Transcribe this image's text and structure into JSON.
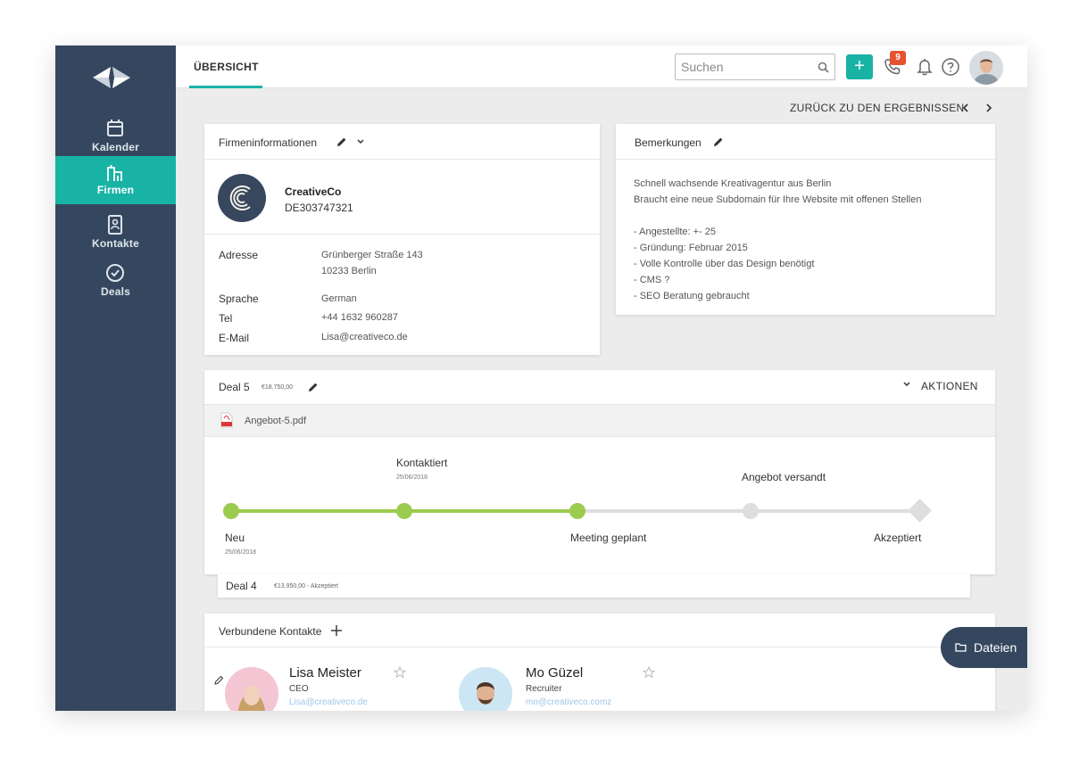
{
  "sidebar": {
    "items": [
      {
        "label": "Kalender",
        "icon": "calendar-icon"
      },
      {
        "label": "Firmen",
        "icon": "buildings-icon",
        "active": true
      },
      {
        "label": "Kontakte",
        "icon": "address-book-icon"
      },
      {
        "label": "Deals",
        "icon": "check-circle-icon"
      }
    ]
  },
  "topbar": {
    "tab": "ÜBERSICHT",
    "search_placeholder": "Suchen",
    "add_label": "+",
    "phone_badge": "9"
  },
  "back_link": "ZURÜCK ZU DEN ERGEBNISSEN",
  "company_card": {
    "title": "Firmeninformationen",
    "name": "CreativeCo",
    "vat": "DE303747321",
    "address_label": "Adresse",
    "address_line1": "Grünberger Straße 143",
    "address_line2": "10233 Berlin",
    "language_label": "Sprache",
    "language": "German",
    "phone_label": "Tel",
    "phone": "+44 1632 960287",
    "email_label": "E-Mail",
    "email": "Lisa@creativeco.de"
  },
  "notes_card": {
    "title": "Bemerkungen",
    "lines": [
      "Schnell wachsende Kreativagentur aus Berlin",
      "Braucht eine neue Subdomain für Ihre Website mit offenen Stellen",
      "- Angestellte: +- 25",
      "- Gründung: Februar 2015",
      "- Volle Kontrolle über das Design benötigt",
      "- CMS ?",
      "- SEO Beratung gebraucht"
    ]
  },
  "deal5": {
    "title": "Deal 5",
    "amount": "€18.750,00",
    "actions": "AKTIONEN",
    "file": "Angebot-5.pdf",
    "stages": [
      {
        "label": "Neu",
        "date": "25/06/2018",
        "done": true
      },
      {
        "label": "Kontaktiert",
        "date": "25/06/2018",
        "done": true
      },
      {
        "label": "Meeting geplant",
        "date": "",
        "done": true
      },
      {
        "label": "Angebot versandt",
        "date": "",
        "done": false
      },
      {
        "label": "Akzeptiert",
        "date": "",
        "done": false
      }
    ]
  },
  "deal4": {
    "title": "Deal 4",
    "meta": "€13.950,00 - Akzeptiert"
  },
  "contacts_card": {
    "title": "Verbundene Kontakte",
    "contacts": [
      {
        "name": "Lisa Meister",
        "role": "CEO",
        "email": "Lisa@creativeco.de"
      },
      {
        "name": "Mo Güzel",
        "role": "Recruiter",
        "email": "mo@creativeco.comz"
      }
    ]
  },
  "files_button": "Dateien",
  "colors": {
    "sidebar": "#35475f",
    "accent": "#19b3a6",
    "progress_done": "#9bcb4f",
    "progress_todo": "#dedede",
    "badge": "#e5532e"
  }
}
